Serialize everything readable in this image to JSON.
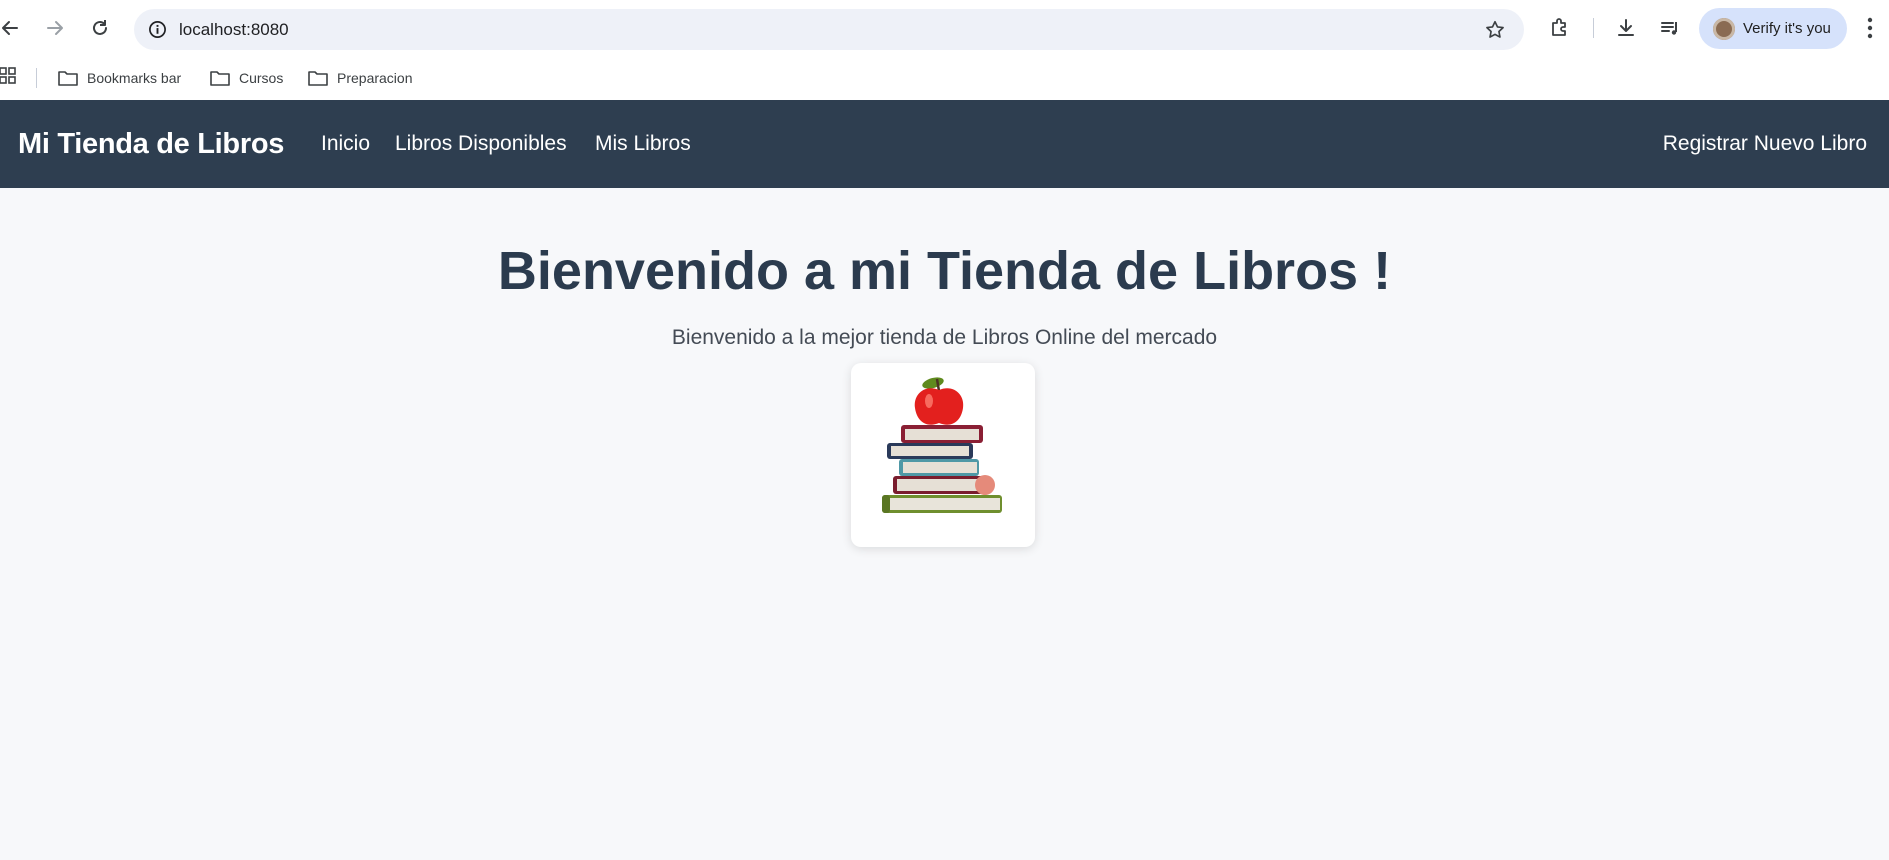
{
  "browser": {
    "url": "localhost:8080",
    "verify_label": "Verify it's you",
    "bookmarks": [
      {
        "label": "Bookmarks bar"
      },
      {
        "label": "Cursos"
      },
      {
        "label": "Preparacion"
      }
    ],
    "icons": [
      "back-icon",
      "forward-icon",
      "reload-icon",
      "site-info-icon",
      "bookmark-star-icon",
      "extensions-icon",
      "downloads-icon",
      "media-controls-icon",
      "profile-avatar",
      "more-menu-icon",
      "apps-grid-icon",
      "folder-icon"
    ]
  },
  "navbar": {
    "brand": "Mi Tienda de Libros",
    "links": [
      {
        "label": "Inicio"
      },
      {
        "label": "Libros Disponibles"
      },
      {
        "label": "Mis Libros"
      }
    ],
    "right_link": "Registrar Nuevo Libro",
    "background": "#2e3e50"
  },
  "hero": {
    "title": "Bienvenido a mi Tienda de Libros !",
    "subtitle": "Bienvenido a la mejor tienda de Libros Online del mercado",
    "image_icon": "book-stack-with-apple-illustration"
  },
  "colors": {
    "page_bg": "#f7f8fa",
    "title": "#2b3b4e",
    "omnibox_bg": "#eef1f8",
    "verify_bg": "#d6e2fb"
  }
}
